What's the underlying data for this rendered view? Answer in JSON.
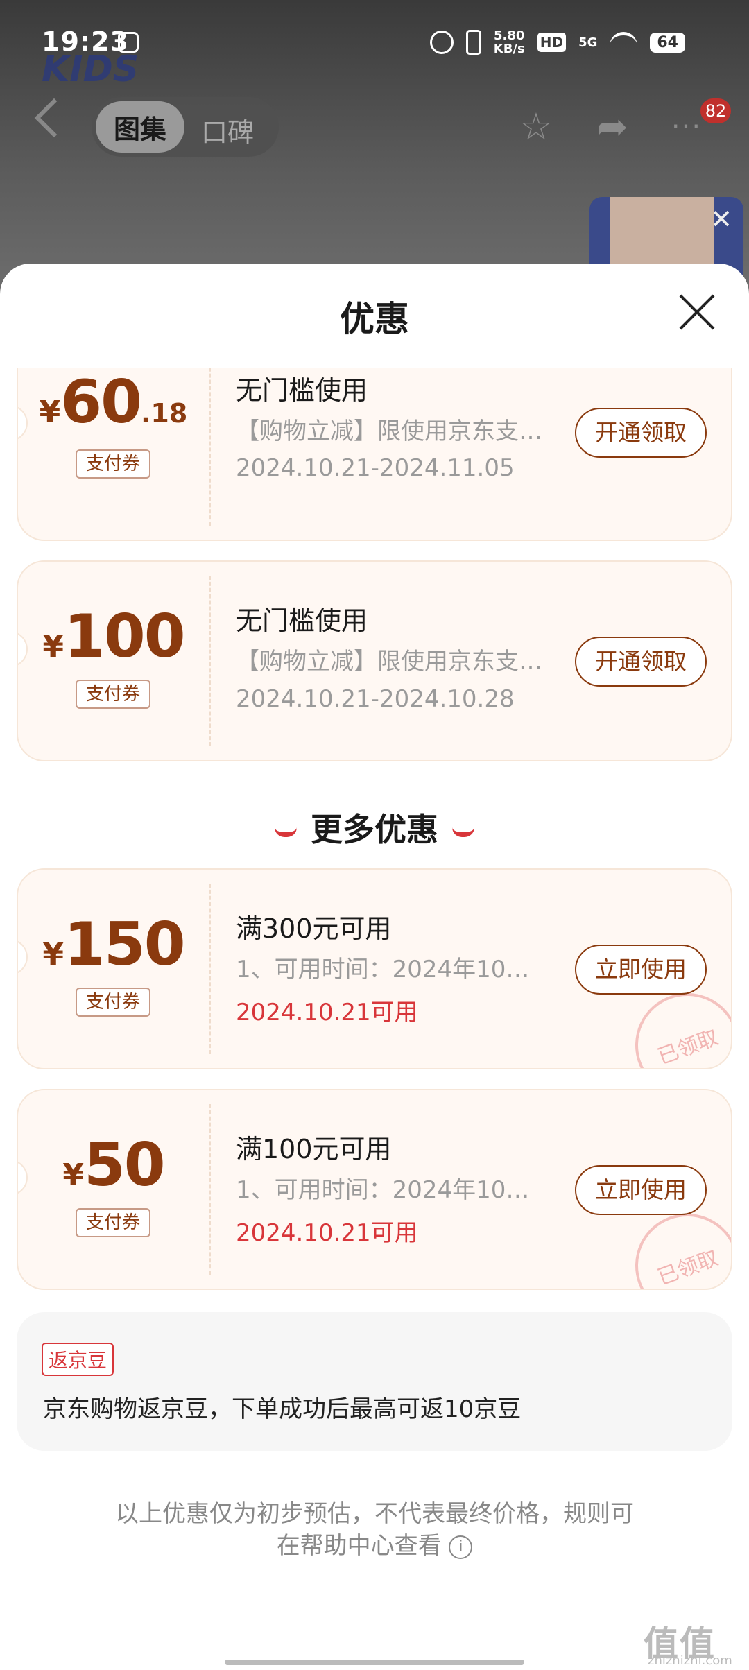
{
  "status_bar": {
    "time": "19:23",
    "speed_value": "5.80",
    "speed_unit": "KB/s",
    "hd": "HD",
    "network": "5G",
    "battery": "64"
  },
  "app_header": {
    "brand": "KIDS",
    "tabs": [
      "图集",
      "口碑"
    ],
    "badge_count": "82"
  },
  "sheet": {
    "title": "优惠",
    "coupons": [
      {
        "yen": "¥",
        "amount": "60",
        "decimal": ".18",
        "tag": "支付券",
        "title": "无门槛使用",
        "desc": "【购物立减】限使用京东支…",
        "date": "2024.10.21-2024.11.05",
        "button": "开通领取"
      },
      {
        "yen": "¥",
        "amount": "100",
        "decimal": "",
        "tag": "支付券",
        "title": "无门槛使用",
        "desc": "【购物立减】限使用京东支…",
        "date": "2024.10.21-2024.10.28",
        "button": "开通领取"
      }
    ],
    "more_section_title": "更多优惠",
    "more_coupons": [
      {
        "yen": "¥",
        "amount": "150",
        "tag": "支付券",
        "title": "满300元可用",
        "desc": "1、可用时间：2024年10…",
        "date": "2024.10.21可用",
        "button": "立即使用",
        "stamp": "已领取"
      },
      {
        "yen": "¥",
        "amount": "50",
        "tag": "支付券",
        "title": "满100元可用",
        "desc": "1、可用时间：2024年10…",
        "date": "2024.10.21可用",
        "button": "立即使用",
        "stamp": "已领取"
      }
    ],
    "return_beans": {
      "tag": "返京豆",
      "text": "京东购物返京豆，下单成功后最高可返10京豆"
    },
    "footer_note_line1": "以上优惠仅为初步预估，不代表最终价格，规则可",
    "footer_note_line2": "在帮助中心查看",
    "info_glyph": "i"
  },
  "watermark": {
    "main": "值值值",
    "sub": "zhizhizhi.com"
  },
  "colors": {
    "brand_brown": "#8a3a0e",
    "accent_red": "#d8363a",
    "coupon_bg": "#fff8f3"
  }
}
